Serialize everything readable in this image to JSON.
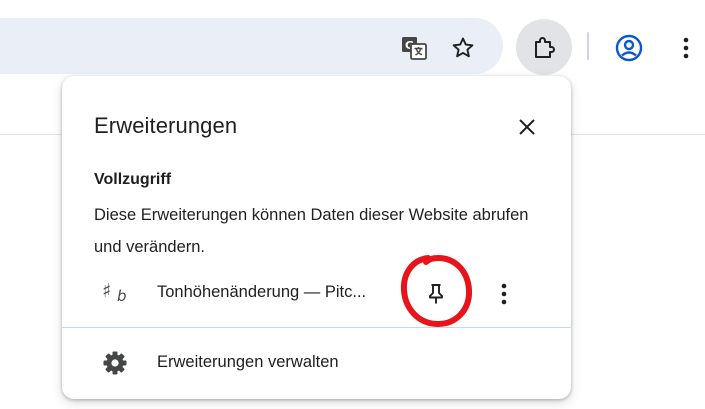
{
  "toolbar": {
    "icons": [
      "translate-icon",
      "star-icon",
      "extensions-icon",
      "profile-icon",
      "more-vert-icon"
    ],
    "accent_color": "#0b57d0"
  },
  "popup": {
    "title": "Erweiterungen",
    "section": {
      "title": "Vollzugriff",
      "description": "Diese Erweiterungen können Daten dieser Website abrufen und verändern."
    },
    "extensions": [
      {
        "name": "Tonhöhenänderung — Pitc...",
        "icon": "sharp-flat-icon",
        "icon_glyph": "♯",
        "icon_sub": "b"
      }
    ],
    "manage_label": "Erweiterungen verwalten",
    "annotation_color": "#e8141c"
  }
}
